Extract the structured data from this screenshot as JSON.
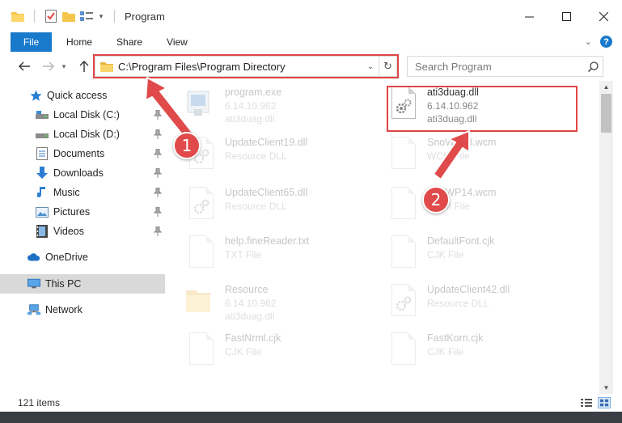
{
  "window": {
    "title": "Program"
  },
  "ribbon": {
    "tabs": [
      "File",
      "Home",
      "Share",
      "View"
    ],
    "help_label": "?"
  },
  "nav": {
    "address_path": "C:\\Program Files\\Program Directory",
    "search_placeholder": "Search Program"
  },
  "sidebar": {
    "items": [
      {
        "label": "Quick access",
        "icon": "star-icon",
        "pinned": false
      },
      {
        "label": "Local Disk (C:)",
        "icon": "drive-icon",
        "pinned": true
      },
      {
        "label": "Local Disk (D:)",
        "icon": "drive-icon",
        "pinned": true
      },
      {
        "label": "Documents",
        "icon": "documents-icon",
        "pinned": true
      },
      {
        "label": "Downloads",
        "icon": "download-icon",
        "pinned": true
      },
      {
        "label": "Music",
        "icon": "music-icon",
        "pinned": true
      },
      {
        "label": "Pictures",
        "icon": "pictures-icon",
        "pinned": true
      },
      {
        "label": "Videos",
        "icon": "videos-icon",
        "pinned": true
      },
      {
        "label": "OneDrive",
        "icon": "cloud-icon",
        "pinned": false
      },
      {
        "label": "This PC",
        "icon": "computer-icon",
        "pinned": false,
        "selected": true
      },
      {
        "label": "Network",
        "icon": "network-icon",
        "pinned": false
      }
    ]
  },
  "files": [
    {
      "name": "program.exe",
      "line2": "6.14.10.962",
      "line3": "ati3duag.dll",
      "icon": "exe-icon",
      "faded": true
    },
    {
      "name": "ati3duag.dll",
      "line2": "6.14.10.962",
      "line3": "ati3duag.dll",
      "icon": "dll-gear-icon",
      "faded": false,
      "highlighted": true
    },
    {
      "name": "UpdateClient19.dll",
      "line2": "Resource DLL",
      "line3": "",
      "icon": "dll-gear-icon",
      "faded": true
    },
    {
      "name": "SnoWP13.wcm",
      "line2": "WCM File",
      "line3": "",
      "icon": "blank-file-icon",
      "faded": true
    },
    {
      "name": "UpdateClient65.dll",
      "line2": "Resource DLL",
      "line3": "",
      "icon": "dll-gear-icon",
      "faded": true
    },
    {
      "name": "SnoWP14.wcm",
      "line2": "WCM File",
      "line3": "",
      "icon": "blank-file-icon",
      "faded": true
    },
    {
      "name": "help.fineReader.txt",
      "line2": "TXT File",
      "line3": "",
      "icon": "blank-file-icon",
      "faded": true
    },
    {
      "name": "DefaultFont.cjk",
      "line2": "CJK File",
      "line3": "",
      "icon": "blank-file-icon",
      "faded": true
    },
    {
      "name": "Resource",
      "line2": "6.14.10.962",
      "line3": "ati3duag.dll",
      "icon": "folder-icon",
      "faded": true
    },
    {
      "name": "UpdateClient42.dll",
      "line2": "Resource DLL",
      "line3": "",
      "icon": "dll-gear-icon",
      "faded": true
    },
    {
      "name": "FastNrml.cjk",
      "line2": "CJK File",
      "line3": "",
      "icon": "blank-file-icon",
      "faded": true
    },
    {
      "name": "FastKorn.cjk",
      "line2": "CJK File",
      "line3": "",
      "icon": "blank-file-icon",
      "faded": true
    }
  ],
  "status": {
    "item_count": "121 items"
  },
  "annotations": {
    "step1": "1",
    "step2": "2",
    "color": "#e04a4a"
  },
  "colors": {
    "accent": "#1979ca",
    "highlight": "#e04545"
  }
}
